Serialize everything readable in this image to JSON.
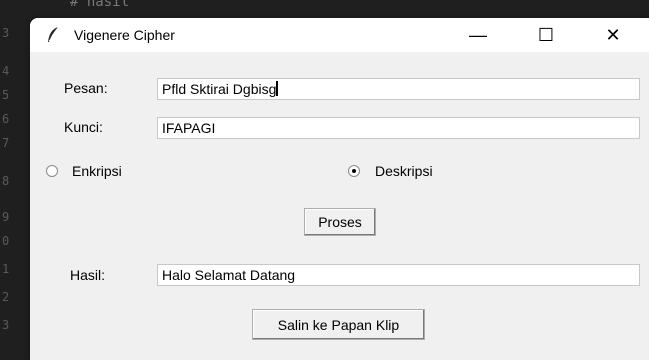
{
  "editor": {
    "code_snippet": "# hasil",
    "line_numbers": [
      "3",
      "4",
      "5",
      "6",
      "7",
      "8",
      "9",
      "0",
      "1",
      "2",
      "3"
    ]
  },
  "window": {
    "title": "Vigenere Cipher",
    "icon": "feather-icon",
    "controls": {
      "minimize": "—",
      "maximize": "☐",
      "close": "✕"
    }
  },
  "form": {
    "pesan_label": "Pesan:",
    "pesan_value": "Pfld Sktirai Dgbisg",
    "kunci_label": "Kunci:",
    "kunci_value": "IFAPAGI",
    "mode_options": [
      {
        "label": "Enkripsi",
        "selected": false
      },
      {
        "label": "Deskripsi",
        "selected": true
      }
    ],
    "process_button": "Proses",
    "hasil_label": "Hasil:",
    "hasil_value": "Halo Selamat Datang",
    "copy_button": "Salin ke Papan Klip"
  }
}
